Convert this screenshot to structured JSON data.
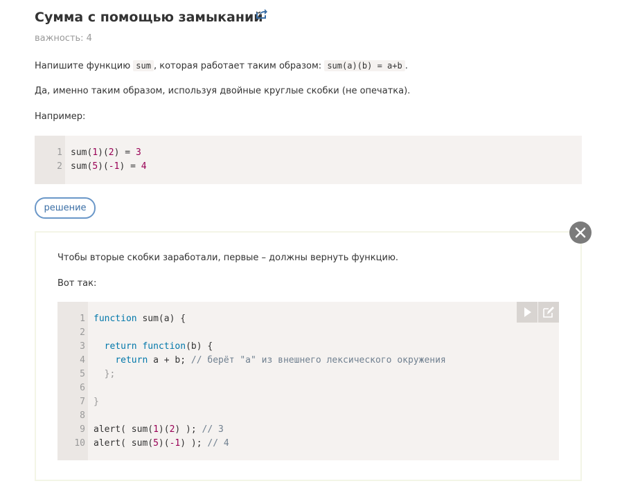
{
  "task": {
    "title": "Сумма с помощью замыканий",
    "importance": "важность: 4"
  },
  "description": {
    "p1_before": "Напишите функцию ",
    "p1_code1": "sum",
    "p1_middle": ", которая работает таким образом: ",
    "p1_code2": "sum(a)(b) = a+b",
    "p1_after": ".",
    "p2": "Да, именно таким образом, используя двойные круглые скобки (не опечатка).",
    "p3": "Например:"
  },
  "example_code": {
    "line_numbers": [
      "1",
      "2"
    ],
    "lines": [
      "sum(1)(2) = 3",
      "sum(5)(-1) = 4"
    ]
  },
  "solution_button": {
    "label": "решение"
  },
  "solution": {
    "p1": "Чтобы вторые скобки заработали, первые – должны вернуть функцию.",
    "p2": "Вот так:",
    "line_numbers": [
      "1",
      "2",
      "3",
      "4",
      "5",
      "6",
      "7",
      "8",
      "9",
      "10"
    ],
    "code": {
      "l1_kw": "function",
      "l1_rest": " sum(a) {",
      "l3_indent": "  ",
      "l3_kw1": "return",
      "l3_sp": " ",
      "l3_kw2": "function",
      "l3_rest": "(b) {",
      "l4_indent": "    ",
      "l4_kw": "return",
      "l4_rest": " a + b; ",
      "l4_comment": "// берёт \"a\" из внешнего лексического окружения",
      "l5": "  };",
      "l7": "}",
      "l9_a": "alert( sum(",
      "l9_n1": "1",
      "l9_b": ")(",
      "l9_n2": "2",
      "l9_c": ") ); ",
      "l9_comment": "// 3",
      "l10_a": "alert( sum(",
      "l10_n1": "5",
      "l10_b": ")(",
      "l10_n2": "-1",
      "l10_c": ") ); ",
      "l10_comment": "// 4"
    }
  },
  "icons": {
    "share": "share-icon",
    "close": "close-icon",
    "run": "play-icon",
    "edit": "edit-icon"
  },
  "colors": {
    "keyword": "#0077aa",
    "number": "#990055",
    "comment": "#708090",
    "code_background": "#f5f2f0",
    "button_border": "#6a97c8",
    "close_button": "#7b7b7b"
  }
}
